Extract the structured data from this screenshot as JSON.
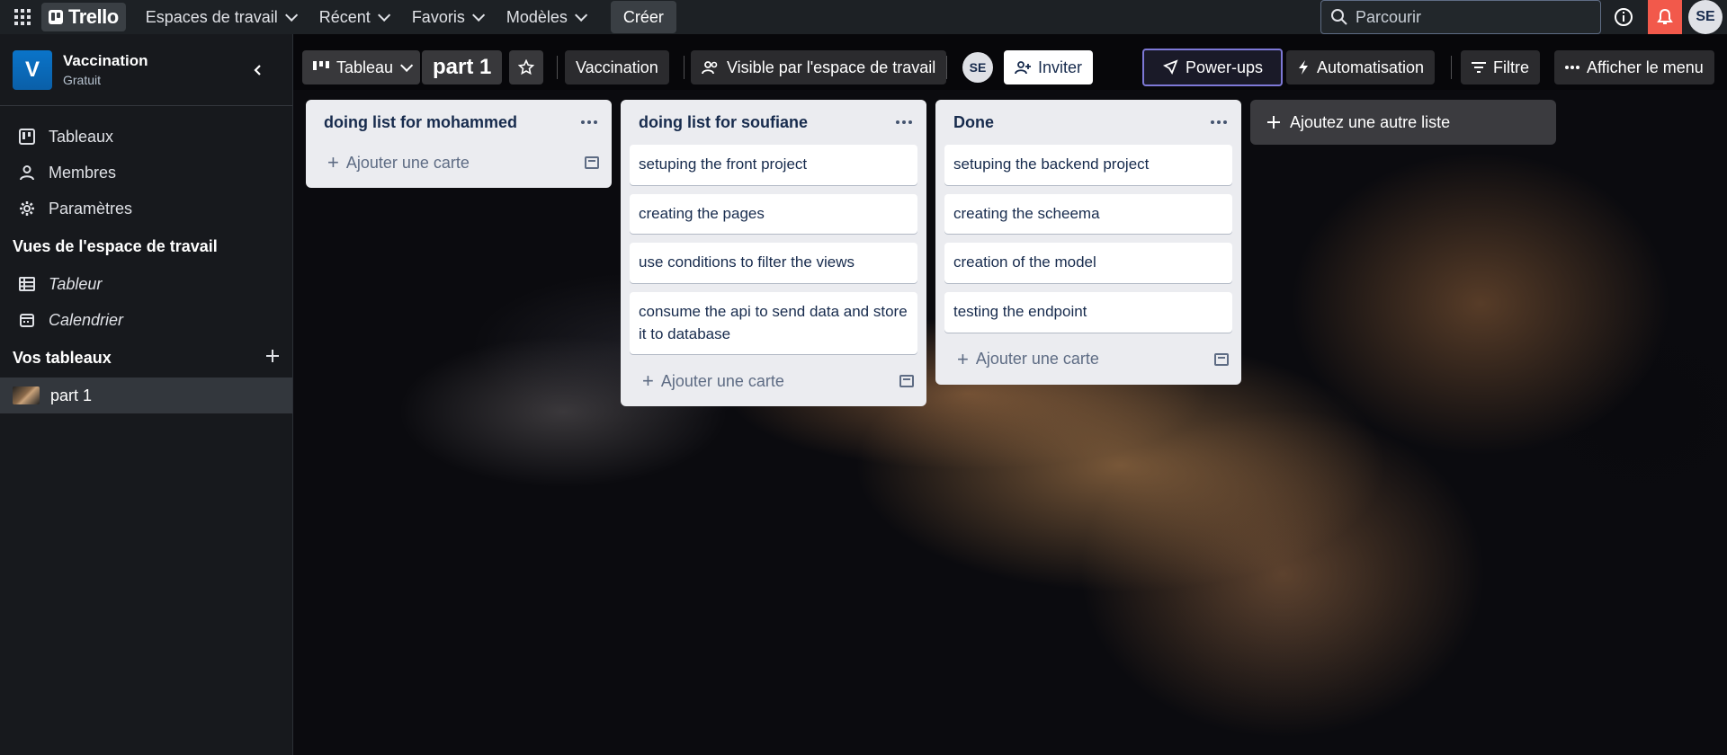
{
  "topnav": {
    "logo": "Trello",
    "menus": [
      {
        "label": "Espaces de travail"
      },
      {
        "label": "Récent"
      },
      {
        "label": "Favoris"
      },
      {
        "label": "Modèles"
      }
    ],
    "create_label": "Créer",
    "search_placeholder": "Parcourir",
    "avatar_initials": "SE"
  },
  "sidebar": {
    "workspace_initial": "V",
    "workspace_name": "Vaccination",
    "workspace_plan": "Gratuit",
    "items": [
      {
        "label": "Tableaux",
        "icon": "trello-board-icon"
      },
      {
        "label": "Membres",
        "icon": "person-icon"
      },
      {
        "label": "Paramètres",
        "icon": "gear-icon"
      }
    ],
    "views_title": "Vues de l'espace de travail",
    "views": [
      {
        "label": "Tableur",
        "icon": "table-icon"
      },
      {
        "label": "Calendrier",
        "icon": "calendar-icon"
      }
    ],
    "boards_title": "Vos tableaux",
    "boards": [
      {
        "label": "part 1"
      }
    ]
  },
  "board_header": {
    "view_switch": "Tableau",
    "board_name": "part 1",
    "workspace": "Vaccination",
    "visibility": "Visible par l'espace de travail",
    "member_initials": "SE",
    "invite": "Inviter",
    "powerups": "Power-ups",
    "automation": "Automatisation",
    "filter": "Filtre",
    "menu": "Afficher le menu"
  },
  "lists": [
    {
      "title": "doing list for mohammed",
      "cards": [],
      "add_card": "Ajouter une carte"
    },
    {
      "title": "doing list for soufiane",
      "cards": [
        "setuping the front project",
        "creating the pages",
        "use conditions to filter the views",
        "consume the api to send data and store it to database"
      ],
      "add_card": "Ajouter une carte"
    },
    {
      "title": "Done",
      "cards": [
        "setuping the backend project",
        "creating the scheema",
        "creation of the model",
        "testing the endpoint"
      ],
      "add_card": "Ajouter une carte"
    }
  ],
  "add_list": "Ajoutez une autre liste",
  "colors": {
    "accent_bell": "#f2594b",
    "nav_bg": "#1d2125",
    "list_bg": "#ebecf0",
    "powerups_border": "#7d78d6"
  }
}
